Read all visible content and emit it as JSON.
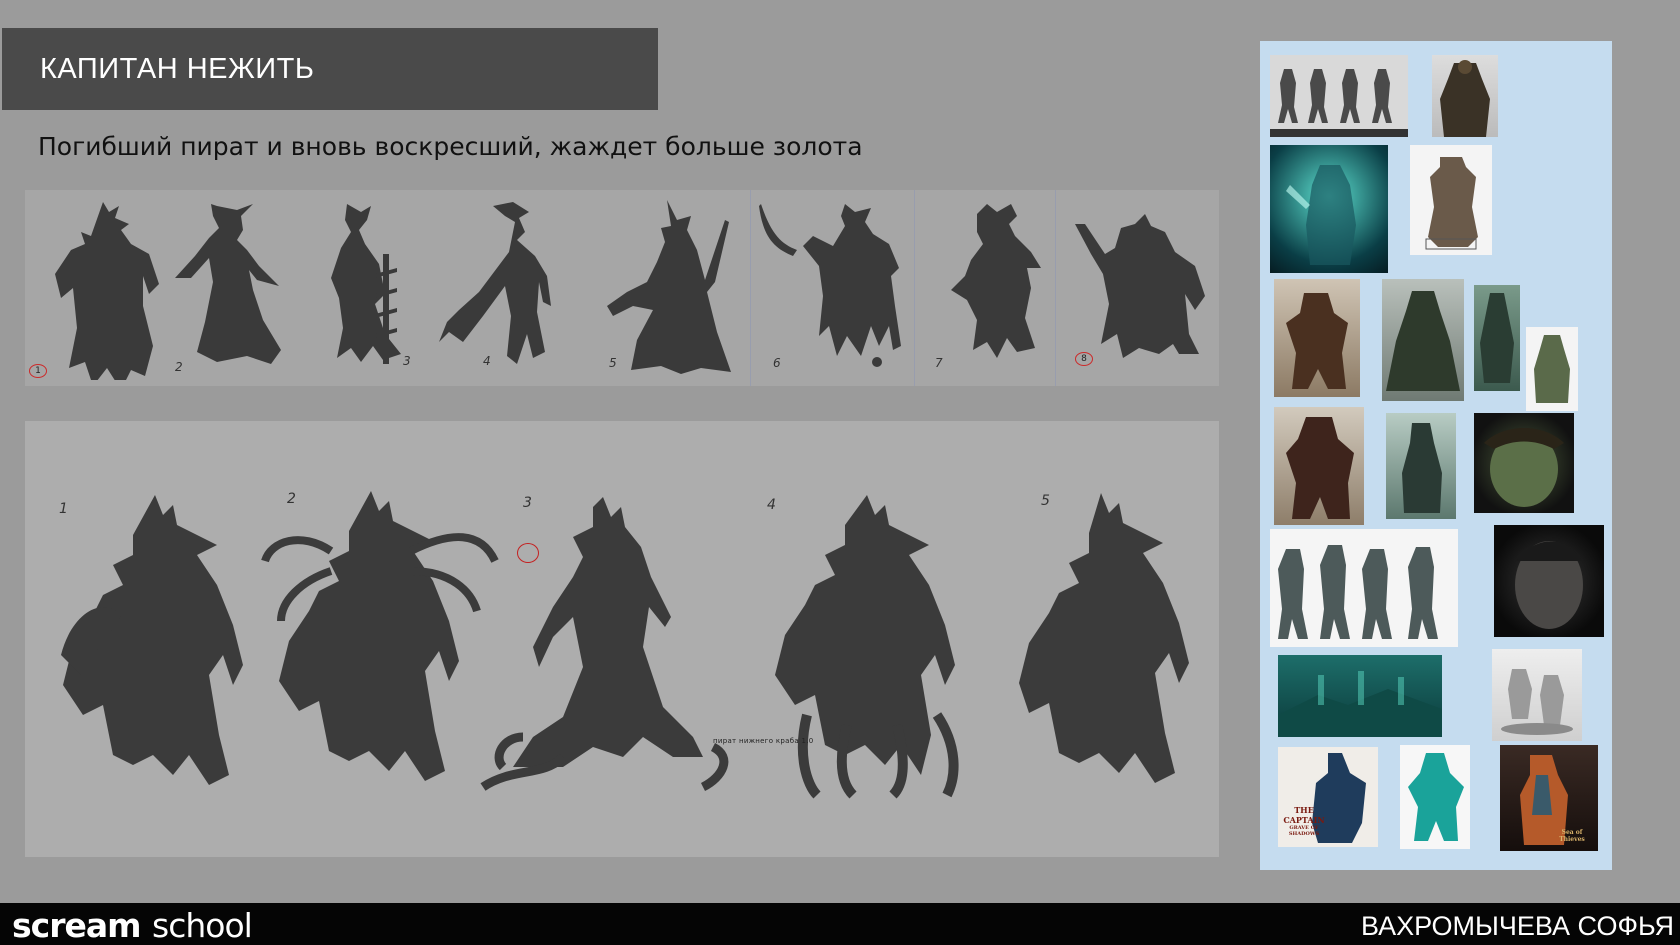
{
  "slide": {
    "title": "КАПИТАН НЕЖИТЬ",
    "subtitle": "Погибший пират и вновь воскресший, жаждет больше золота"
  },
  "silhouette_row": {
    "labels": [
      "1",
      "2",
      "3",
      "4",
      "5",
      "6",
      "7",
      "8"
    ],
    "selected": [
      "1",
      "8"
    ]
  },
  "variant_row": {
    "labels": [
      "1",
      "2",
      "3",
      "4",
      "5"
    ],
    "scrawl_note": "пират нижнего краба 1.0"
  },
  "reference_board": {
    "poster_title": "THE CAPTAIN",
    "poster_sub": "GRAVE OF SHADOWS",
    "game_logo": "Sea of Thieves"
  },
  "footer": {
    "logo_bold": "scream",
    "logo_light": "school",
    "author": "ВАХРОМЫЧЕВА СОФЬЯ"
  },
  "colors": {
    "background": "#9b9b9b",
    "title_bar": "#4a4a4a",
    "silhouette": "#3a3a3a",
    "reference_panel": "#c5dcef",
    "footer": "#050505",
    "marker": "#c42020"
  }
}
